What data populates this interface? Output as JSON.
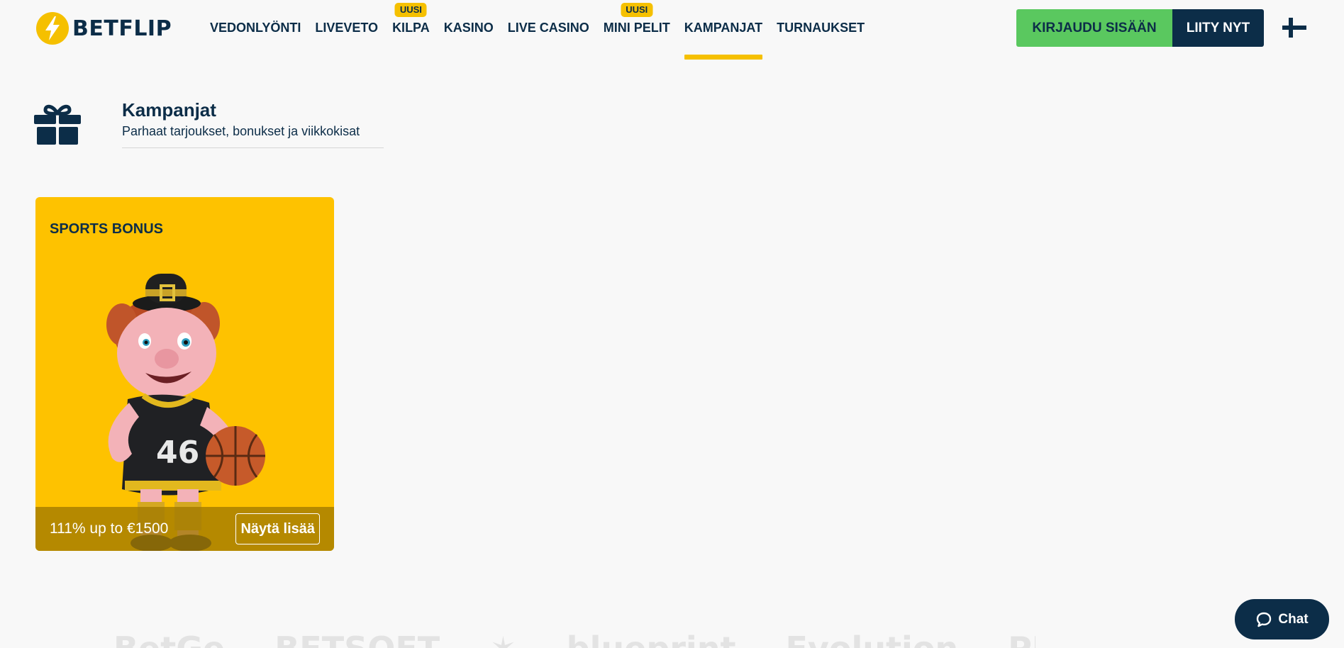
{
  "brand": {
    "name": "BETFLIP"
  },
  "nav": {
    "items": [
      {
        "label": "VEDONLYÖNTI",
        "badge": ""
      },
      {
        "label": "LIVEVETO",
        "badge": ""
      },
      {
        "label": "KILPA",
        "badge": "UUSI"
      },
      {
        "label": "KASINO",
        "badge": ""
      },
      {
        "label": "LIVE CASINO",
        "badge": ""
      },
      {
        "label": "MINI PELIT",
        "badge": "UUSI"
      },
      {
        "label": "KAMPANJAT",
        "badge": "",
        "active": true
      },
      {
        "label": "TURNAUKSET",
        "badge": ""
      }
    ]
  },
  "auth": {
    "login_label": "KIRJAUDU SISÄÄN",
    "join_label": "LIITY NYT"
  },
  "language": {
    "icon": "finland-flag-icon"
  },
  "page": {
    "title": "Kampanjat",
    "subtitle": "Parhaat tarjoukset, bonukset ja viikkokisat",
    "icon": "gift-icon"
  },
  "promos": [
    {
      "title": "SPORTS BONUS",
      "offer": "111% up to €1500",
      "button_label": "Näytä lisää"
    }
  ],
  "providers": [
    "BetGe",
    "BETSOFT",
    "✶",
    "blueprint",
    "Evolution",
    "PLAYSON"
  ],
  "chat": {
    "label": "Chat"
  },
  "colors": {
    "navy": "#0c2d48",
    "accent_yellow": "#f5c000",
    "card_yellow": "#fec200",
    "login_green": "#5ac85f",
    "background": "#f8f8f8"
  }
}
